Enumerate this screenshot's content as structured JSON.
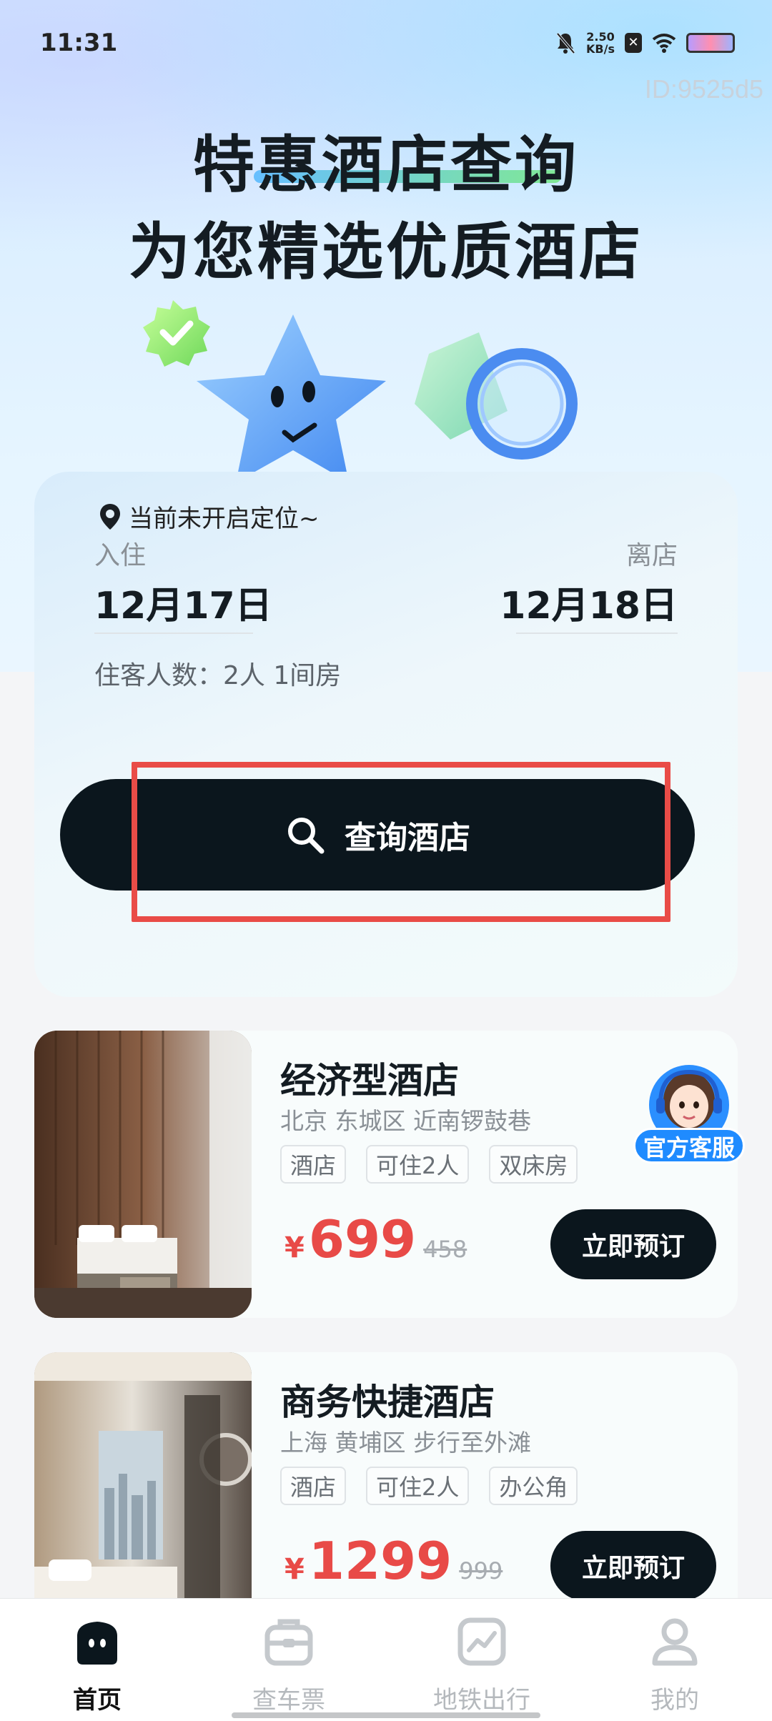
{
  "status_bar": {
    "time": "11:31",
    "speed_value": "2.50",
    "speed_unit": "KB/s"
  },
  "watermark": "ID:9525d5",
  "hero": {
    "title_line1": "特惠酒店查询",
    "title_line2": "为您精选优质酒店"
  },
  "search": {
    "location_text": "当前未开启定位~",
    "checkin_label": "入住",
    "checkout_label": "离店",
    "checkin_date": "12月17日",
    "checkout_date": "12月18日",
    "guests_text": "住客人数：2人 1间房",
    "button_label": "查询酒店"
  },
  "hotels": [
    {
      "name": "经济型酒店",
      "address": "北京 东城区 近南锣鼓巷",
      "tags": [
        "酒店",
        "可住2人",
        "双床房"
      ],
      "currency": "¥",
      "price": "699",
      "original_price": "458",
      "book_label": "立即预订"
    },
    {
      "name": "商务快捷酒店",
      "address": "上海 黄埔区 步行至外滩",
      "tags": [
        "酒店",
        "可住2人",
        "办公角"
      ],
      "currency": "¥",
      "price": "1299",
      "original_price": "999",
      "book_label": "立即预订"
    }
  ],
  "service": {
    "label": "官方客服"
  },
  "tabs": [
    {
      "label": "首页",
      "icon": "home-icon",
      "active": true
    },
    {
      "label": "查车票",
      "icon": "ticket-icon",
      "active": false
    },
    {
      "label": "地铁出行",
      "icon": "metro-chart-icon",
      "active": false
    },
    {
      "label": "我的",
      "icon": "profile-icon",
      "active": false
    }
  ],
  "colors": {
    "accent_dark": "#0b161d",
    "price_red": "#e84a47",
    "highlight_red": "#e94c47",
    "service_blue": "#1f8bff"
  }
}
